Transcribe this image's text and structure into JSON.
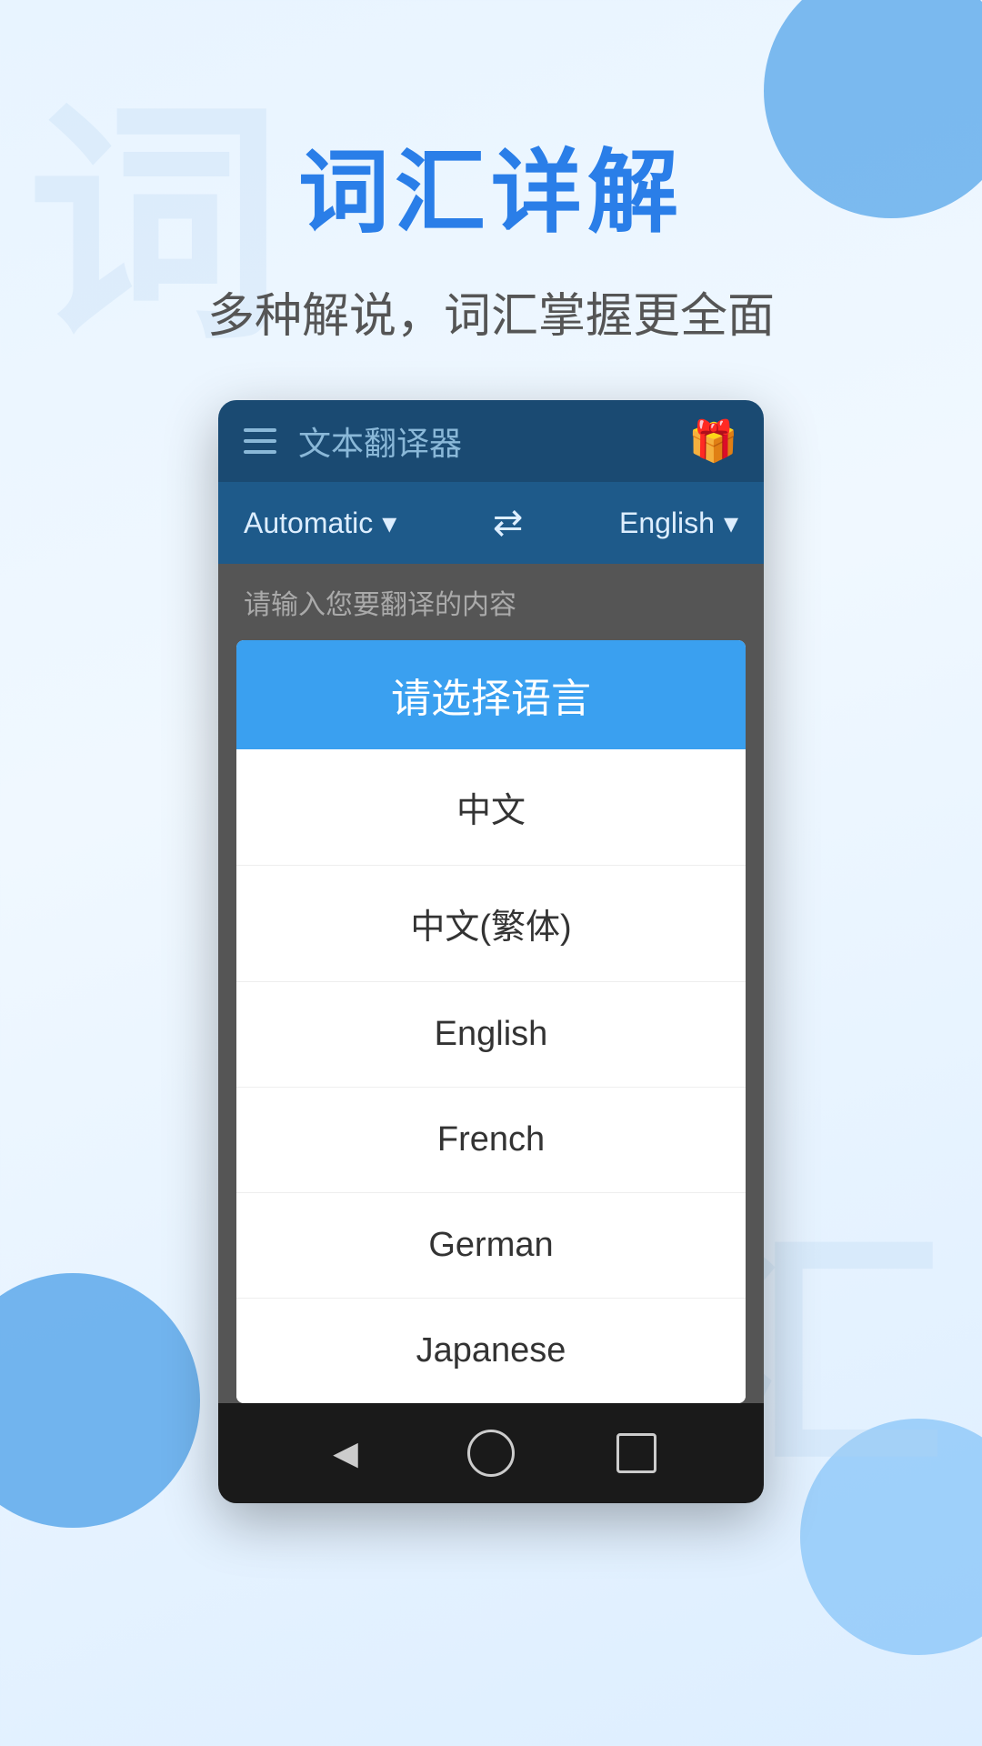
{
  "page": {
    "background": "#e8f4ff"
  },
  "header": {
    "main_title": "词汇详解",
    "sub_title": "多种解说，词汇掌握更全面"
  },
  "app": {
    "toolbar": {
      "title": "文本翻译器",
      "gift_icon": "🎁"
    },
    "lang_bar": {
      "source_lang": "Automatic",
      "target_lang": "English",
      "swap_icon": "⇄"
    },
    "input_placeholder": "请输入您要翻译的内容"
  },
  "dialog": {
    "title": "请选择语言",
    "options": [
      {
        "label": "中文",
        "value": "zh"
      },
      {
        "label": "中文(繁体)",
        "value": "zh-tw"
      },
      {
        "label": "English",
        "value": "en"
      },
      {
        "label": "French",
        "value": "fr"
      },
      {
        "label": "German",
        "value": "de"
      },
      {
        "label": "Japanese",
        "value": "ja"
      }
    ]
  },
  "watermarks": {
    "char1": "词",
    "char2": "汇"
  },
  "bottom_nav": {
    "back_label": "◀",
    "home_label": "○",
    "recent_label": "□"
  }
}
